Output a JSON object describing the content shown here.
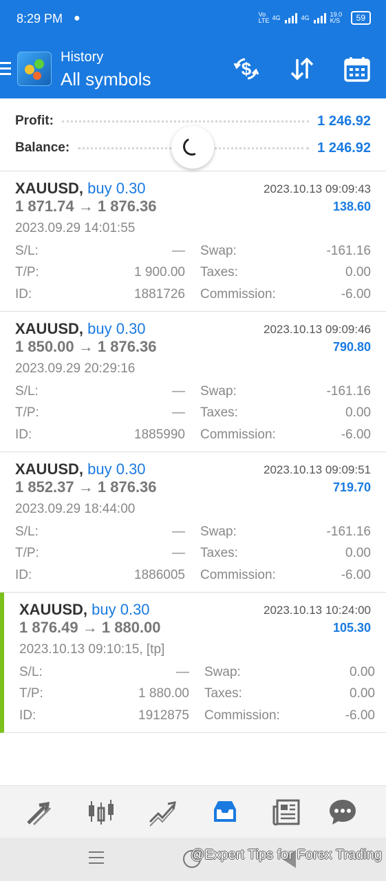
{
  "status_bar": {
    "time": "8:29 PM",
    "network1": "Vo LTE",
    "network2": "4G",
    "network3": "4G",
    "speed": "19.0 K/S",
    "battery": "59"
  },
  "header": {
    "title": "History",
    "subtitle": "All symbols",
    "icons": [
      "menu-icon",
      "app-logo",
      "currency-exchange-icon",
      "sort-icon",
      "calendar-icon"
    ]
  },
  "summary": {
    "profit_label": "Profit:",
    "profit_value": "1 246.92",
    "balance_label": "Balance:",
    "balance_value": "1 246.92"
  },
  "deals": [
    {
      "symbol": "XAUUSD,",
      "direction": "buy 0.30",
      "close_time": "2023.10.13 09:09:43",
      "open_price": "1 871.74",
      "arrow": "→",
      "close_price": "1 876.36",
      "profit": "138.60",
      "open_time": "2023.09.29 14:01:55",
      "sl_label": "S/L:",
      "sl": "—",
      "tp_label": "T/P:",
      "tp": "1 900.00",
      "id_label": "ID:",
      "id": "1881726",
      "swap_label": "Swap:",
      "swap": "-161.16",
      "taxes_label": "Taxes:",
      "taxes": "0.00",
      "commission_label": "Commission:",
      "commission": "-6.00"
    },
    {
      "symbol": "XAUUSD,",
      "direction": "buy 0.30",
      "close_time": "2023.10.13 09:09:46",
      "open_price": "1 850.00",
      "arrow": "→",
      "close_price": "1 876.36",
      "profit": "790.80",
      "open_time": "2023.09.29 20:29:16",
      "sl_label": "S/L:",
      "sl": "—",
      "tp_label": "T/P:",
      "tp": "—",
      "id_label": "ID:",
      "id": "1885990",
      "swap_label": "Swap:",
      "swap": "-161.16",
      "taxes_label": "Taxes:",
      "taxes": "0.00",
      "commission_label": "Commission:",
      "commission": "-6.00"
    },
    {
      "symbol": "XAUUSD,",
      "direction": "buy 0.30",
      "close_time": "2023.10.13 09:09:51",
      "open_price": "1 852.37",
      "arrow": "→",
      "close_price": "1 876.36",
      "profit": "719.70",
      "open_time": "2023.09.29 18:44:00",
      "sl_label": "S/L:",
      "sl": "—",
      "tp_label": "T/P:",
      "tp": "—",
      "id_label": "ID:",
      "id": "1886005",
      "swap_label": "Swap:",
      "swap": "-161.16",
      "taxes_label": "Taxes:",
      "taxes": "0.00",
      "commission_label": "Commission:",
      "commission": "-6.00"
    },
    {
      "symbol": "XAUUSD,",
      "direction": "buy 0.30",
      "close_time": "2023.10.13 10:24:00",
      "open_price": "1 876.49",
      "arrow": "→",
      "close_price": "1 880.00",
      "profit": "105.30",
      "open_time": "2023.10.13 09:10:15, [tp]",
      "sl_label": "S/L:",
      "sl": "—",
      "tp_label": "T/P:",
      "tp": "1 880.00",
      "id_label": "ID:",
      "id": "1912875",
      "swap_label": "Swap:",
      "swap": "0.00",
      "taxes_label": "Taxes:",
      "taxes": "0.00",
      "commission_label": "Commission:",
      "commission": "-6.00"
    }
  ],
  "bottom_nav": {
    "items": [
      "quotes-icon",
      "chart-icon",
      "trade-icon",
      "history-icon",
      "news-icon",
      "chat-icon"
    ],
    "active": "history-icon",
    "accent": "#1a7ae0"
  },
  "watermark": "@Expert Tips for Forex Trading"
}
